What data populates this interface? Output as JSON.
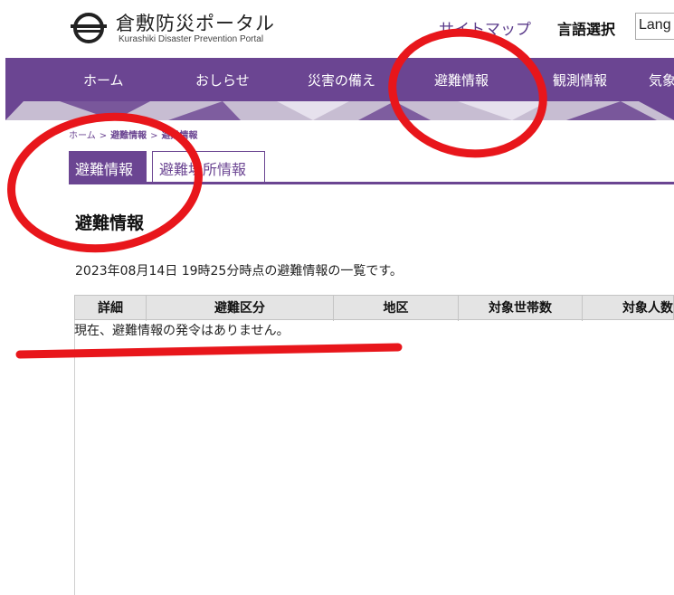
{
  "header": {
    "title": "倉敷防災ポータル",
    "subtitle": "Kurashiki Disaster Prevention Portal",
    "sitemap": "サイトマップ",
    "language_label": "言語選択",
    "language_value": "Lang"
  },
  "nav": {
    "items": [
      "ホーム",
      "おしらせ",
      "災害の備え",
      "避難情報",
      "観測情報",
      "気象"
    ]
  },
  "breadcrumb": {
    "items": [
      "ホーム",
      "避難情報",
      "避難情報"
    ],
    "separator": ">"
  },
  "tabs": {
    "active": "避難情報",
    "other": "避難場所情報"
  },
  "main": {
    "heading": "避難情報",
    "timestamp": "2023年08月14日 19時25分時点の避難情報の一覧です。"
  },
  "table": {
    "headers": [
      "詳細",
      "避難区分",
      "地区",
      "対象世帯数",
      "対象人数"
    ],
    "empty_message": "現在、避難情報の発令はありません。"
  },
  "colors": {
    "brand": "#6b4592",
    "annotation": "#e8161b"
  }
}
